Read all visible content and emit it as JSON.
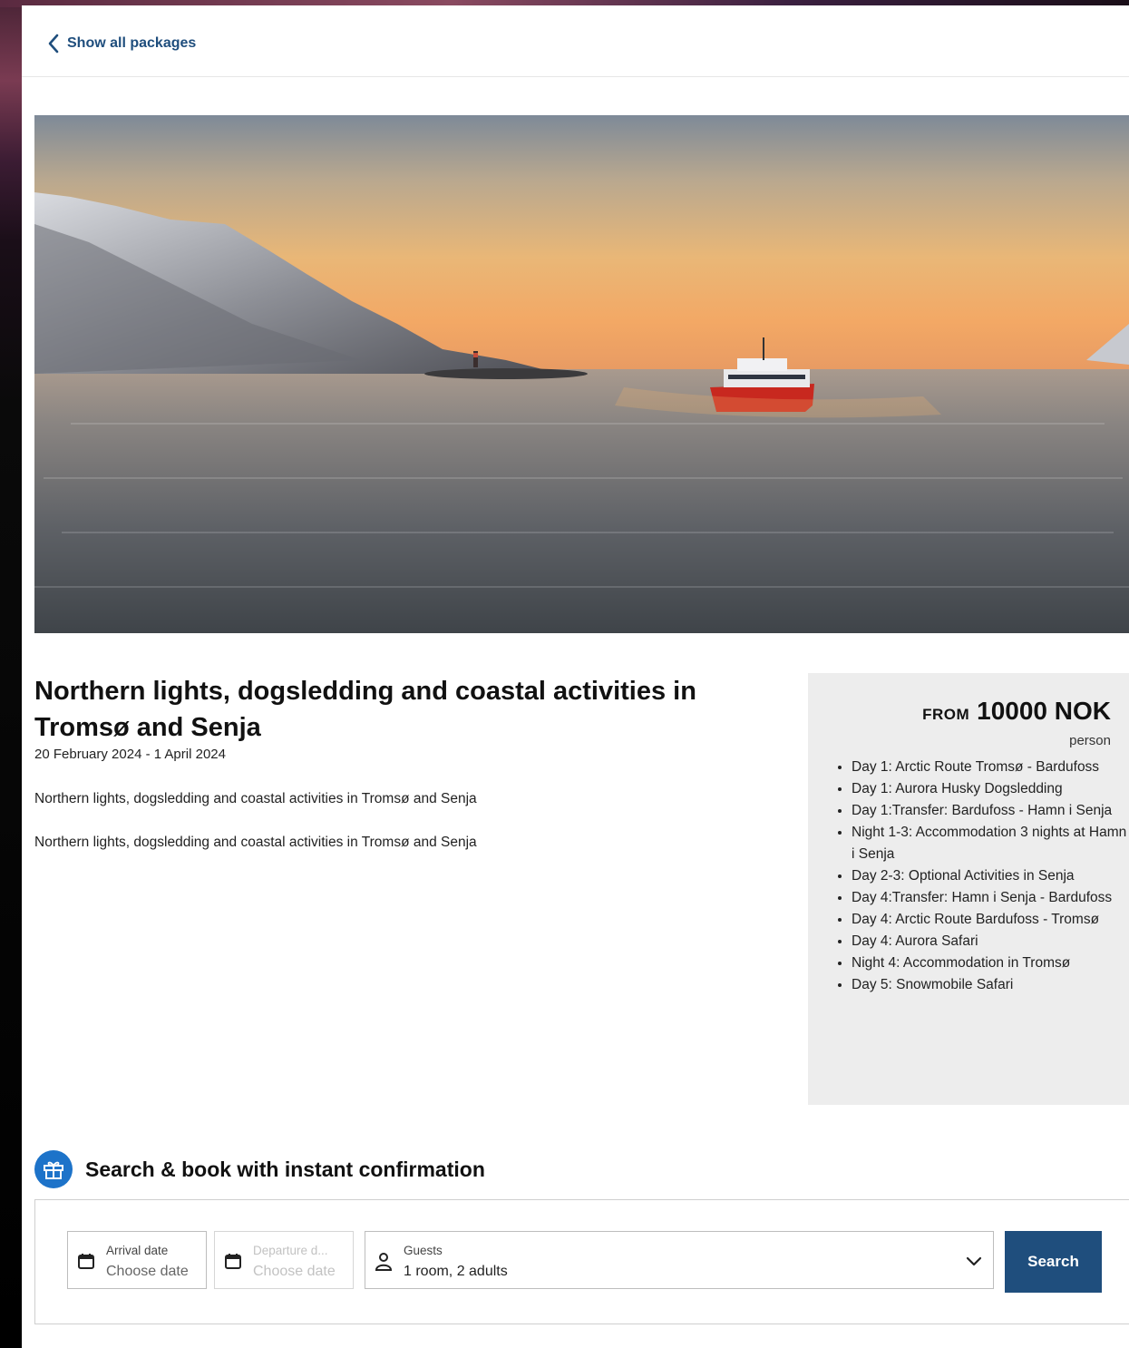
{
  "nav": {
    "back_label": "Show all packages"
  },
  "package": {
    "title": "Northern lights, dogsledding and coastal activities in Tromsø and Senja",
    "dates": "20 February 2024 - 1 April 2024",
    "description_1": "Northern lights, dogsledding and coastal activities in Tromsø and Senja",
    "description_2": "Northern lights, dogsledding and coastal activities in Tromsø and Senja"
  },
  "price": {
    "from_label": "FROM",
    "amount": "10000 NOK",
    "per": "person"
  },
  "itinerary": [
    "Day 1: Arctic Route Tromsø - Bardufoss",
    "Day 1: Aurora Husky Dogsledding",
    "Day 1:Transfer: Bardufoss - Hamn i Senja",
    "Night 1-3: Accommodation 3 nights at Hamn i Senja",
    "Day 2-3: Optional Activities in Senja",
    "Day 4:Transfer: Hamn i Senja - Bardufoss",
    "Day 4: Arctic Route Bardufoss - Tromsø",
    "Day 4: Aurora Safari",
    "Night 4: Accommodation in Tromsø",
    "Day 5: Snowmobile Safari"
  ],
  "booking": {
    "title": "Search & book with instant confirmation",
    "arrival_label": "Arrival date",
    "arrival_value": "Choose date",
    "departure_label": "Departure d...",
    "departure_value": "Choose date",
    "guests_label": "Guests",
    "guests_value": "1 room, 2 adults",
    "search_label": "Search"
  },
  "colors": {
    "link": "#1f4e7d",
    "primary_button": "#1f4e7d",
    "gift_icon_bg": "#1d73c9",
    "price_box_bg": "#ededed"
  },
  "icons": [
    "chevron-left-icon",
    "gift-icon",
    "calendar-icon",
    "person-icon",
    "chevron-down-icon"
  ]
}
